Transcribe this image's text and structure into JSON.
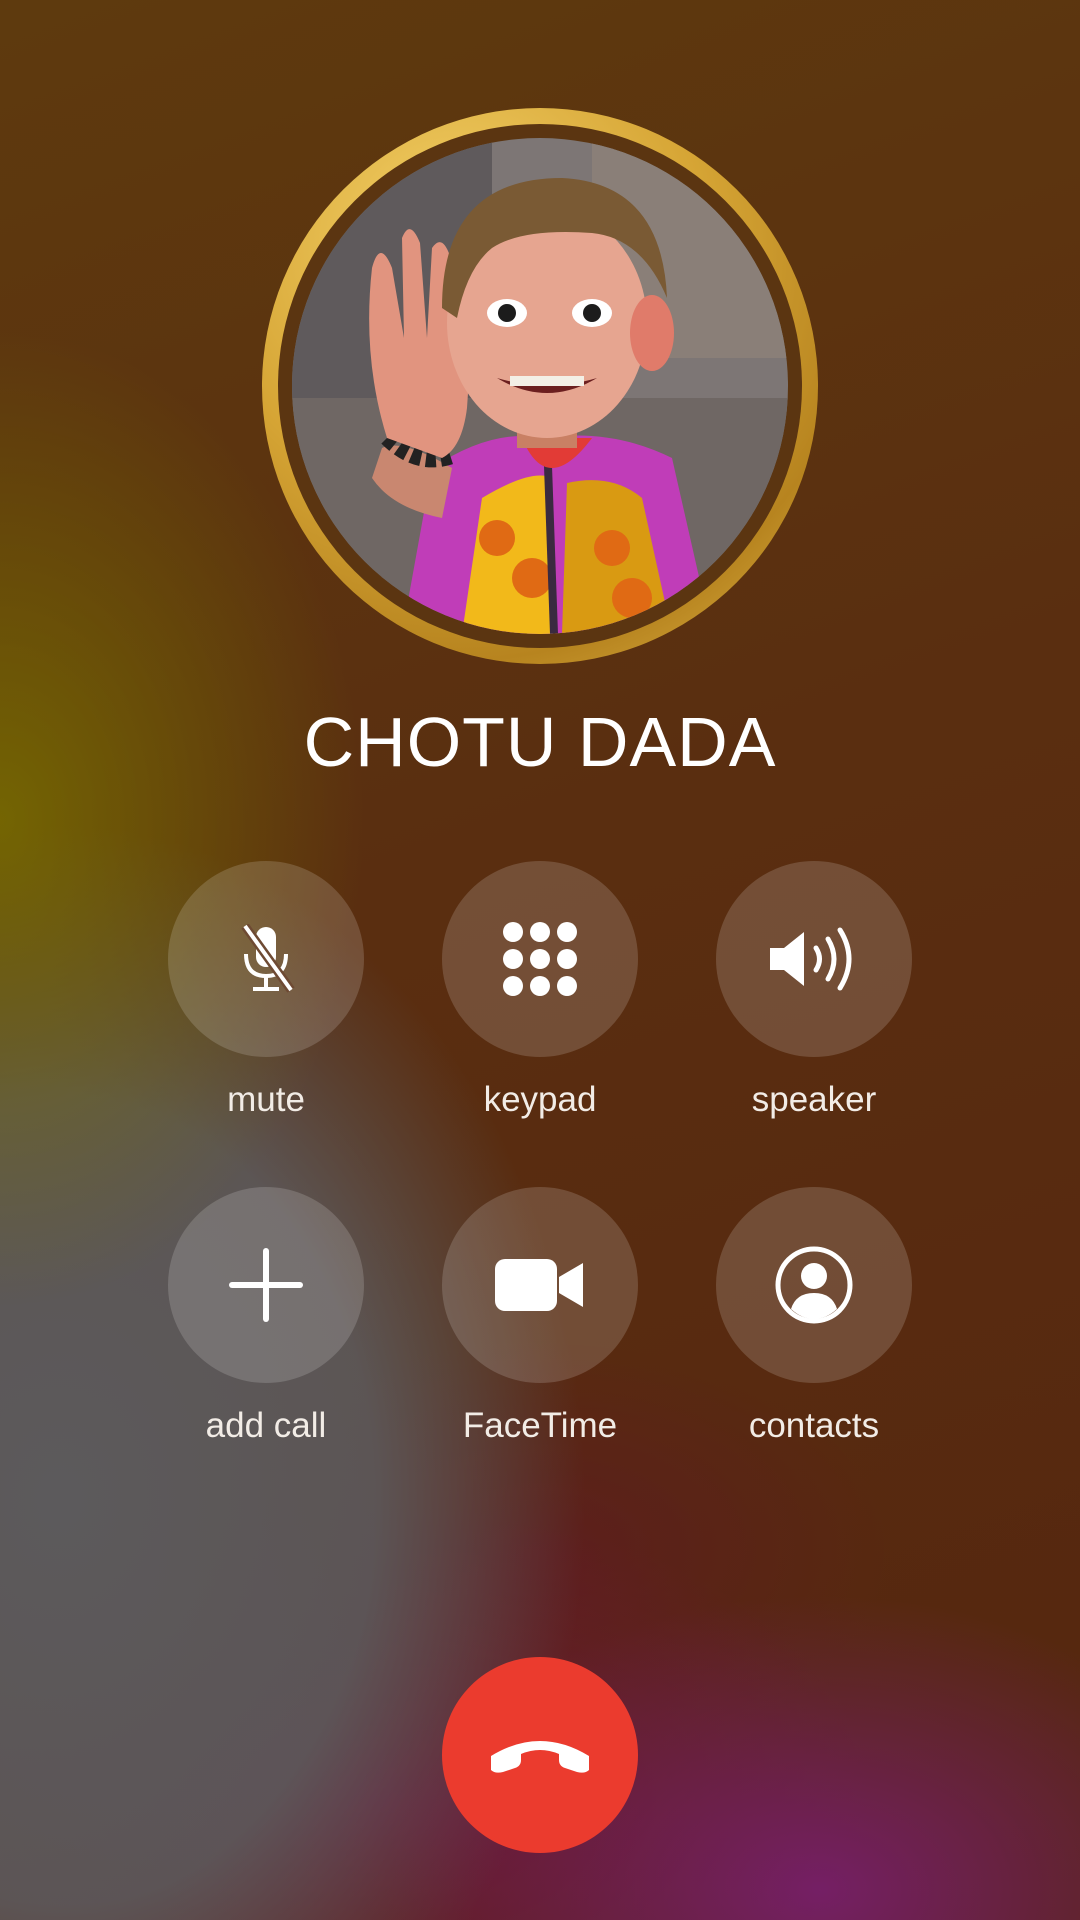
{
  "caller": {
    "name": "CHOTU DADA"
  },
  "controls": [
    {
      "label": "mute",
      "icon": "mic-slash-icon"
    },
    {
      "label": "keypad",
      "icon": "keypad-icon"
    },
    {
      "label": "speaker",
      "icon": "speaker-wave-icon"
    },
    {
      "label": "add call",
      "icon": "plus-icon"
    },
    {
      "label": "FaceTime",
      "icon": "video-camera-icon"
    },
    {
      "label": "contacts",
      "icon": "person-circle-icon"
    }
  ],
  "end_call": {
    "icon": "phone-hangup-icon",
    "color": "#eb3b2e"
  },
  "colors": {
    "avatar_ring": "#d6a535",
    "button_bg": "rgba(255,255,255,0.16)"
  }
}
